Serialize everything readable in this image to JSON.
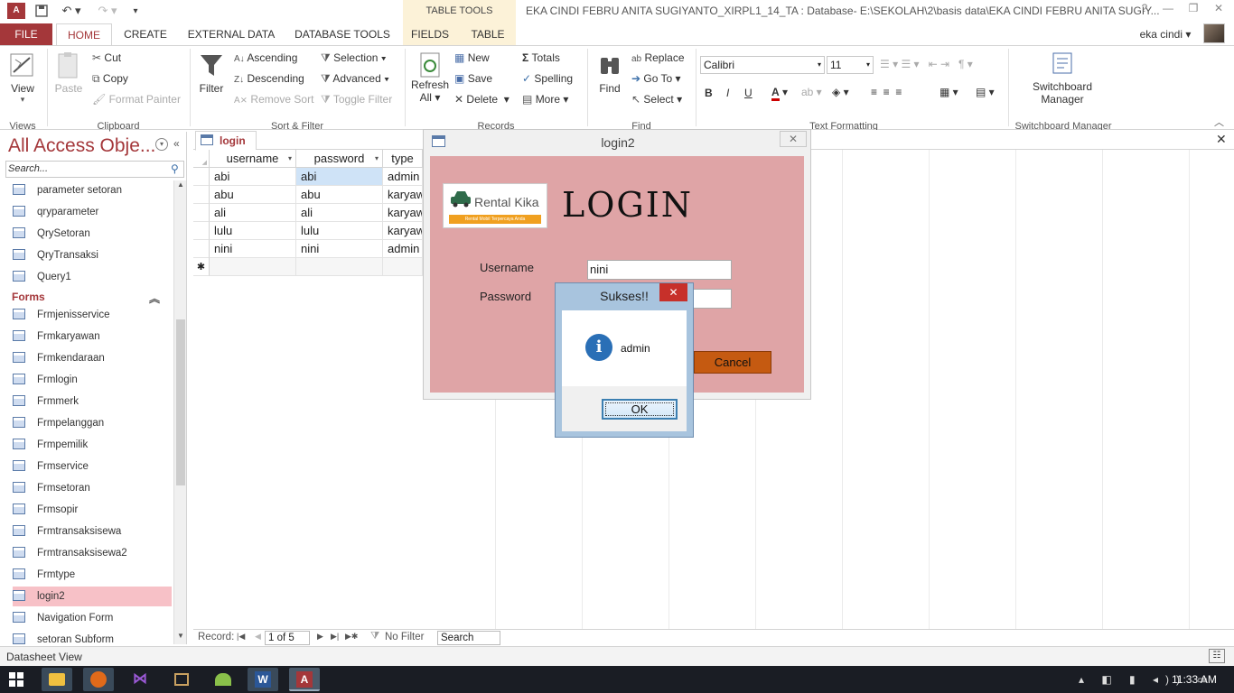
{
  "titlebar": {
    "table_tools": "TABLE TOOLS",
    "window_title": "EKA CINDI FEBRU ANITA SUGIYANTO_XIRPL1_14_TA : Database- E:\\SEKOLAH\\2\\basis data\\EKA CINDI FEBRU ANITA SUGIY...",
    "help": "?",
    "minimize": "—",
    "restore": "❐",
    "close": "✕"
  },
  "tabs": {
    "file": "FILE",
    "home": "HOME",
    "create": "CREATE",
    "external": "EXTERNAL DATA",
    "dbtools": "DATABASE TOOLS",
    "fields": "FIELDS",
    "table": "TABLE",
    "user": "eka cindi"
  },
  "ribbon": {
    "views": {
      "view": "View",
      "group": "Views"
    },
    "clipboard": {
      "paste": "Paste",
      "cut": "Cut",
      "copy": "Copy",
      "format_painter": "Format Painter",
      "group": "Clipboard"
    },
    "sort_filter": {
      "filter": "Filter",
      "ascending": "Ascending",
      "descending": "Descending",
      "remove_sort": "Remove Sort",
      "selection": "Selection",
      "advanced": "Advanced",
      "toggle_filter": "Toggle Filter",
      "group": "Sort & Filter"
    },
    "records": {
      "refresh": "Refresh",
      "refresh_all": "All",
      "new": "New",
      "save": "Save",
      "delete": "Delete",
      "totals": "Totals",
      "spelling": "Spelling",
      "more": "More",
      "group": "Records"
    },
    "find": {
      "find": "Find",
      "replace": "Replace",
      "goto": "Go To",
      "select": "Select",
      "group": "Find"
    },
    "text": {
      "font": "Calibri",
      "size": "11",
      "bold": "B",
      "italic": "I",
      "underline": "U",
      "group": "Text Formatting"
    },
    "switchboard": {
      "label1": "Switchboard",
      "label2": "Manager",
      "group": "Switchboard Manager"
    }
  },
  "nav": {
    "header": "All Access Obje...",
    "search_placeholder": "Search...",
    "items_top": [
      "parameter setoran",
      "qryparameter",
      "QrySetoran",
      "QryTransaksi",
      "Query1"
    ],
    "forms_label": "Forms",
    "forms": [
      "Frmjenisservice",
      "Frmkaryawan",
      "Frmkendaraan",
      "Frmlogin",
      "Frmmerk",
      "Frmpelanggan",
      "Frmpemilik",
      "Frmservice",
      "Frmsetoran",
      "Frmsopir",
      "Frmtransaksisewa",
      "Frmtransaksisewa2",
      "Frmtype",
      "login2",
      "Navigation Form",
      "setoran Subform"
    ],
    "selected": "login2"
  },
  "doc": {
    "tab": "login",
    "columns": [
      "username",
      "password",
      "type"
    ],
    "rows": [
      [
        "abi",
        "abi",
        "admin"
      ],
      [
        "abu",
        "abu",
        "karyaw"
      ],
      [
        "ali",
        "ali",
        "karyaw"
      ],
      [
        "lulu",
        "lulu",
        "karyaw"
      ],
      [
        "nini",
        "nini",
        "admin"
      ]
    ],
    "new_row_marker": "✱"
  },
  "recnav": {
    "label": "Record:",
    "position": "1 of 5",
    "filter": "No Filter",
    "search": "Search"
  },
  "status": {
    "view": "Datasheet View"
  },
  "taskbar": {
    "time": "11:33 AM"
  },
  "form": {
    "title": "login2",
    "logo_name": "Rental Kika",
    "logo_tagline": "Rental Mobil Terpercaya Anda",
    "heading": "LOGIN",
    "username_label": "Username",
    "username_value": "nini",
    "password_label": "Password",
    "cancel": "Cancel"
  },
  "msgbox": {
    "title": "Sukses!!",
    "text": "admin",
    "ok": "OK"
  },
  "colors": {
    "accent": "#a4373a",
    "form_bg": "#dfa4a6",
    "cancel_btn": "#c55a11",
    "selected_nav": "#f7c1c7"
  }
}
